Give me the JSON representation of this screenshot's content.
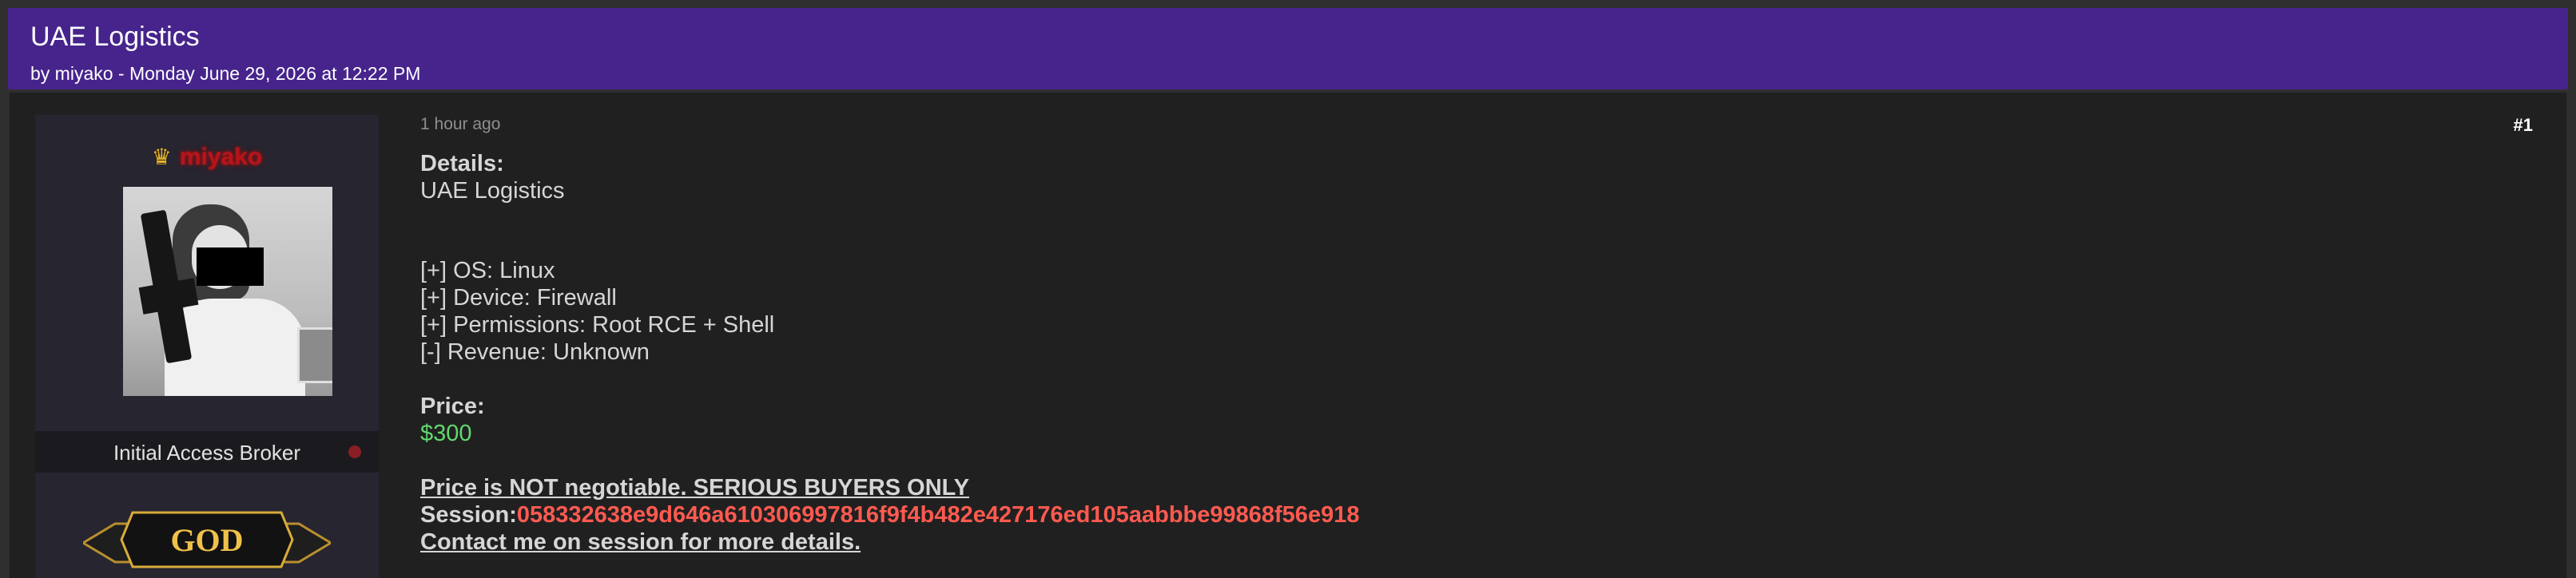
{
  "thread": {
    "title": "UAE Logistics",
    "byline": "by miyako - Monday June 29, 2026 at 12:22 PM"
  },
  "post": {
    "time_ago": "1 hour ago",
    "number": "#1",
    "author": {
      "username": "miyako",
      "role": "Initial Access Broker",
      "rank_badge_text": "GOD",
      "status_color": "#8a1e25",
      "name_color": "#b5151a",
      "crown_color": "#e8b323"
    },
    "details_label": "Details:",
    "details_value": "UAE Logistics",
    "specs": [
      "[+] OS: Linux",
      "[+] Device: Firewall",
      "[+] Permissions: Root RCE + Shell",
      "[-] Revenue: Unknown"
    ],
    "price_label": "Price:",
    "price_value": "$300",
    "notice": "Price is NOT negotiable. SERIOUS BUYERS ONLY",
    "session_label": "Session:",
    "session_id": "058332638e9d646a610306997816f9f4b482e427176ed105aabbbe99868f56e918",
    "contact": "Contact me on session for more details."
  },
  "colors": {
    "header_bg": "#46248c",
    "post_bg": "#202020",
    "price_green": "#61d86f",
    "session_red": "#ff5a50"
  }
}
